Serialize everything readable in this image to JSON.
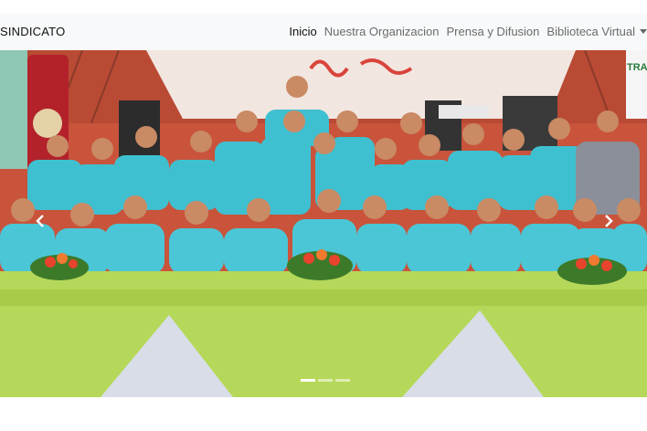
{
  "navbar": {
    "brand": "SINDICATO",
    "links": [
      {
        "label": "Inicio",
        "active": true
      },
      {
        "label": "Nuestra Organizacion"
      },
      {
        "label": "Prensa y Difusion"
      },
      {
        "label": "Biblioteca Virtual",
        "dropdown": true
      }
    ]
  },
  "carousel": {
    "photo_description_icon": "group-photo",
    "banner_text": "TRA",
    "slide_count": 3,
    "active_slide": 1,
    "prev_icon": "chevron-left-icon",
    "next_icon": "chevron-right-icon"
  },
  "colors": {
    "shirt": "#3fc0d0",
    "tablecloth": "#b5d85a",
    "backdrop": "#d45a3a"
  }
}
